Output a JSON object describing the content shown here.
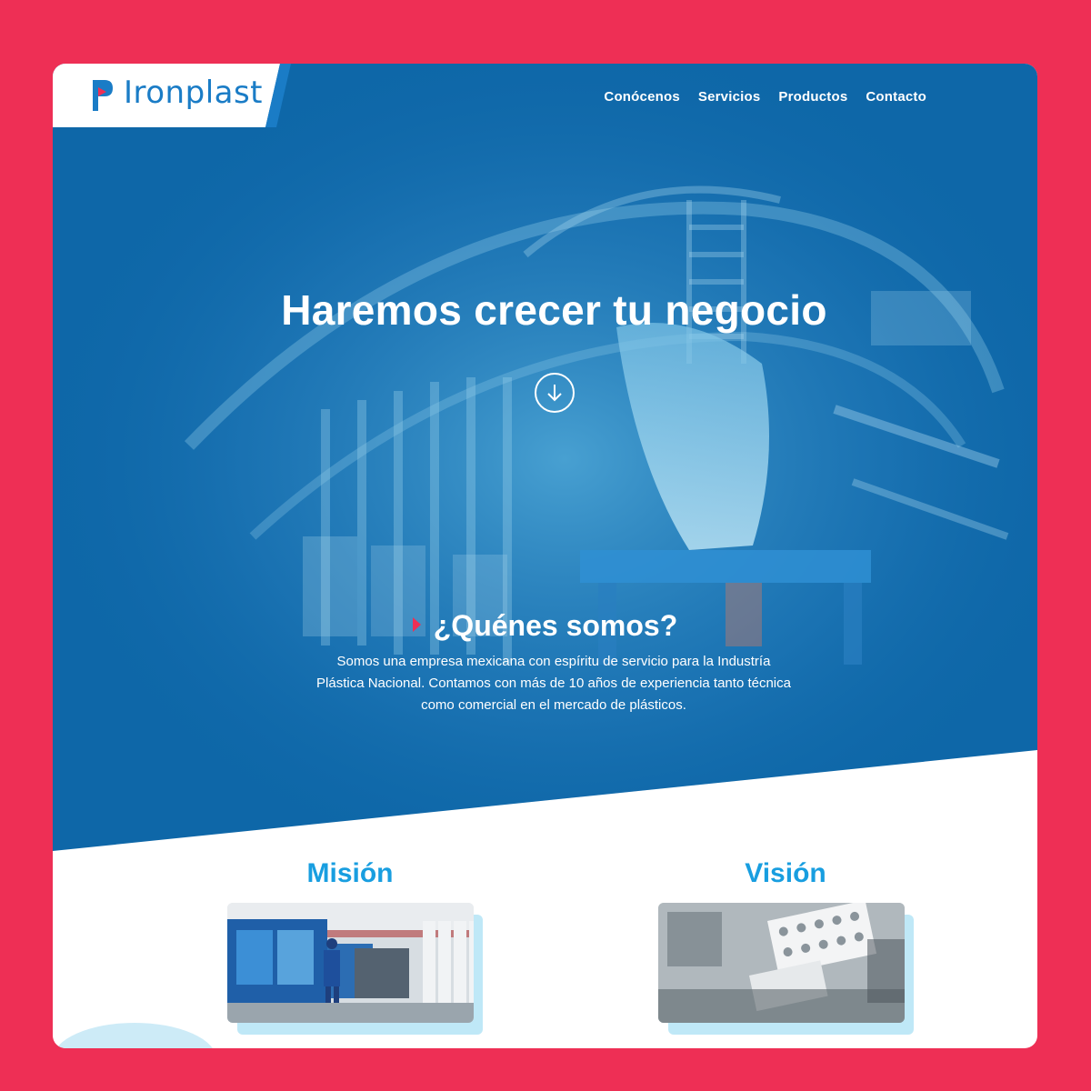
{
  "brand": {
    "name": "Ironplast",
    "primary": "#0e67a8",
    "accent": "#ee2f55",
    "light_blue": "#189ee0"
  },
  "nav": {
    "items": [
      {
        "label": "Conócenos"
      },
      {
        "label": "Servicios"
      },
      {
        "label": "Productos"
      },
      {
        "label": "Contacto"
      }
    ]
  },
  "hero": {
    "title": "Haremos crecer tu negocio",
    "scroll_icon": "arrow-down-circle-icon",
    "background_image": "industrial-plastic-machinery"
  },
  "about": {
    "title": "¿Quénes somos?",
    "text": "Somos una empresa mexicana con espíritu de servicio para la Industría Plástica Nacional. Contamos con más de 10 años de experiencia tanto técnica como comercial en el mercado de plásticos."
  },
  "sections": {
    "mission": {
      "title": "Misión",
      "image": "factory-worker-injection-machines"
    },
    "vision": {
      "title": "Visión",
      "image": "lab-test-tube-racks"
    }
  }
}
